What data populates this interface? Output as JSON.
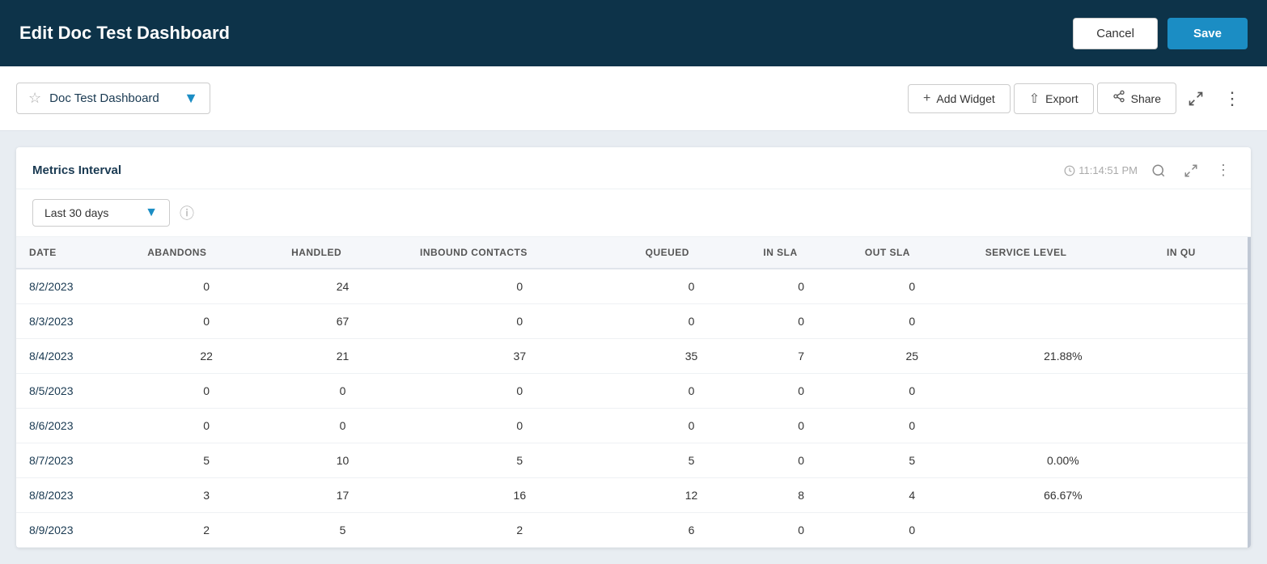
{
  "top_header": {
    "title": "Edit Doc Test Dashboard",
    "cancel_label": "Cancel",
    "save_label": "Save"
  },
  "sub_header": {
    "dashboard_name": "Doc Test Dashboard",
    "add_widget_label": "Add Widget",
    "export_label": "Export",
    "share_label": "Share"
  },
  "widget": {
    "title": "Metrics Interval",
    "timestamp": "11:14:51 PM",
    "filter_label": "Last 30 days"
  },
  "table": {
    "columns": [
      "DATE",
      "ABANDONS",
      "HANDLED",
      "INBOUND CONTACTS",
      "QUEUED",
      "IN SLA",
      "OUT SLA",
      "SERVICE LEVEL",
      "IN QU"
    ],
    "rows": [
      {
        "date": "8/2/2023",
        "abandons": "0",
        "handled": "24",
        "inbound": "0",
        "queued": "0",
        "in_sla": "0",
        "out_sla": "0",
        "service_level": "",
        "in_qu": ""
      },
      {
        "date": "8/3/2023",
        "abandons": "0",
        "handled": "67",
        "inbound": "0",
        "queued": "0",
        "in_sla": "0",
        "out_sla": "0",
        "service_level": "",
        "in_qu": ""
      },
      {
        "date": "8/4/2023",
        "abandons": "22",
        "handled": "21",
        "inbound": "37",
        "queued": "35",
        "in_sla": "7",
        "out_sla": "25",
        "service_level": "21.88%",
        "in_qu": ""
      },
      {
        "date": "8/5/2023",
        "abandons": "0",
        "handled": "0",
        "inbound": "0",
        "queued": "0",
        "in_sla": "0",
        "out_sla": "0",
        "service_level": "",
        "in_qu": ""
      },
      {
        "date": "8/6/2023",
        "abandons": "0",
        "handled": "0",
        "inbound": "0",
        "queued": "0",
        "in_sla": "0",
        "out_sla": "0",
        "service_level": "",
        "in_qu": ""
      },
      {
        "date": "8/7/2023",
        "abandons": "5",
        "handled": "10",
        "inbound": "5",
        "queued": "5",
        "in_sla": "0",
        "out_sla": "5",
        "service_level": "0.00%",
        "in_qu": ""
      },
      {
        "date": "8/8/2023",
        "abandons": "3",
        "handled": "17",
        "inbound": "16",
        "queued": "12",
        "in_sla": "8",
        "out_sla": "4",
        "service_level": "66.67%",
        "in_qu": ""
      },
      {
        "date": "8/9/2023",
        "abandons": "2",
        "handled": "5",
        "inbound": "2",
        "queued": "6",
        "in_sla": "0",
        "out_sla": "0",
        "service_level": "",
        "in_qu": ""
      }
    ]
  }
}
